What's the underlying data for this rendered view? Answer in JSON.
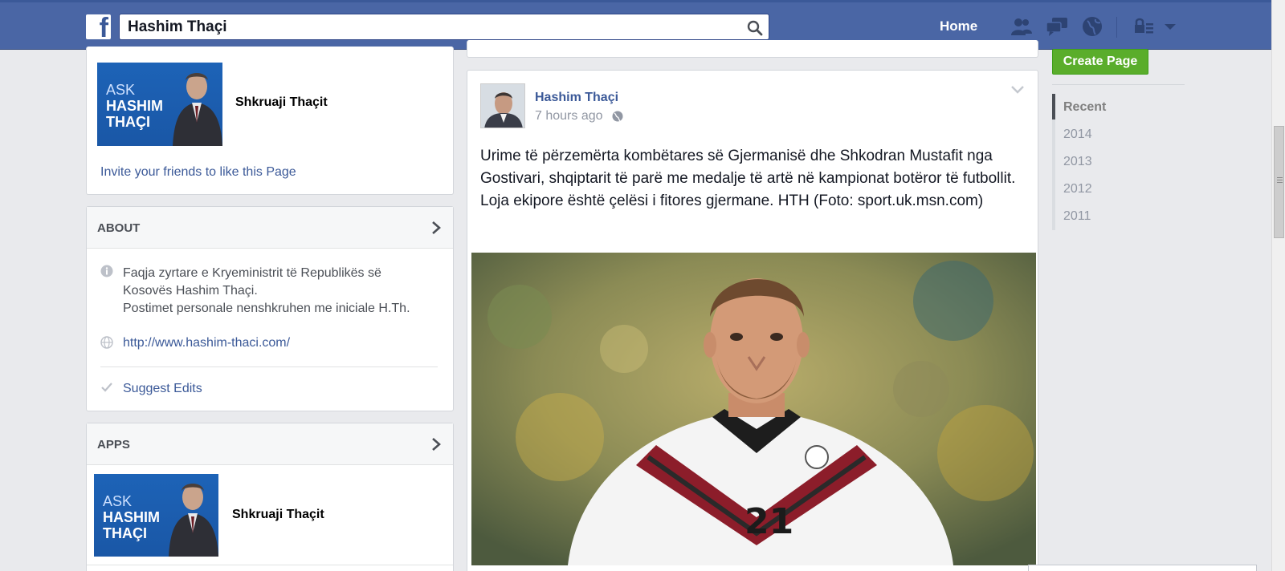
{
  "topbar": {
    "search_value": "Hashim Thaçi",
    "home_label": "Home",
    "icons": [
      "facebook-logo",
      "search-icon",
      "friend-requests-icon",
      "messages-icon",
      "notifications-globe-icon",
      "privacy-lock-icon",
      "account-menu-chevron-icon"
    ]
  },
  "left_column": {
    "app_card": {
      "thumb": {
        "ask": "ASK",
        "line1": "HASHIM",
        "line2": "THAÇI"
      },
      "page_name": "Shkruaji Thaçit",
      "invite_link": "Invite your friends to like this Page"
    },
    "about": {
      "title": "ABOUT",
      "description_line1": "Faqja zyrtare e Kryeministrit të Republikës së",
      "description_line2": "Kosovës Hashim Thaçi.",
      "description_line3": "Postimet personale nenshkruhen me iniciale H.Th.",
      "website": "http://www.hashim-thaci.com/",
      "suggest_edits": "Suggest Edits"
    },
    "apps": {
      "title": "APPS",
      "thumb": {
        "ask": "ASK",
        "line1": "HASHIM",
        "line2": "THAÇI"
      },
      "app_name": "Shkruaji Thaçit"
    }
  },
  "post": {
    "author": "Hashim Thaçi",
    "time": "7 hours ago",
    "text": "Urime të përzemërta kombëtares së Gjermanisë dhe Shkodran Mustafit nga Gostivari, shqiptarit të parë me medalje të artë në kampionat botëror të futbollit. Loja ekipore është çelësi i fitores gjermane. HTH (Foto: sport.uk.msn.com)",
    "photo_shirt_number": "21"
  },
  "right_column": {
    "create_page": "Create Page",
    "years": [
      "Recent",
      "2014",
      "2013",
      "2012",
      "2011"
    ]
  },
  "colors": {
    "topbar": "#4a66a5",
    "link": "#3b5998",
    "create_button": "#5aad2b",
    "background": "#e9eaed"
  }
}
